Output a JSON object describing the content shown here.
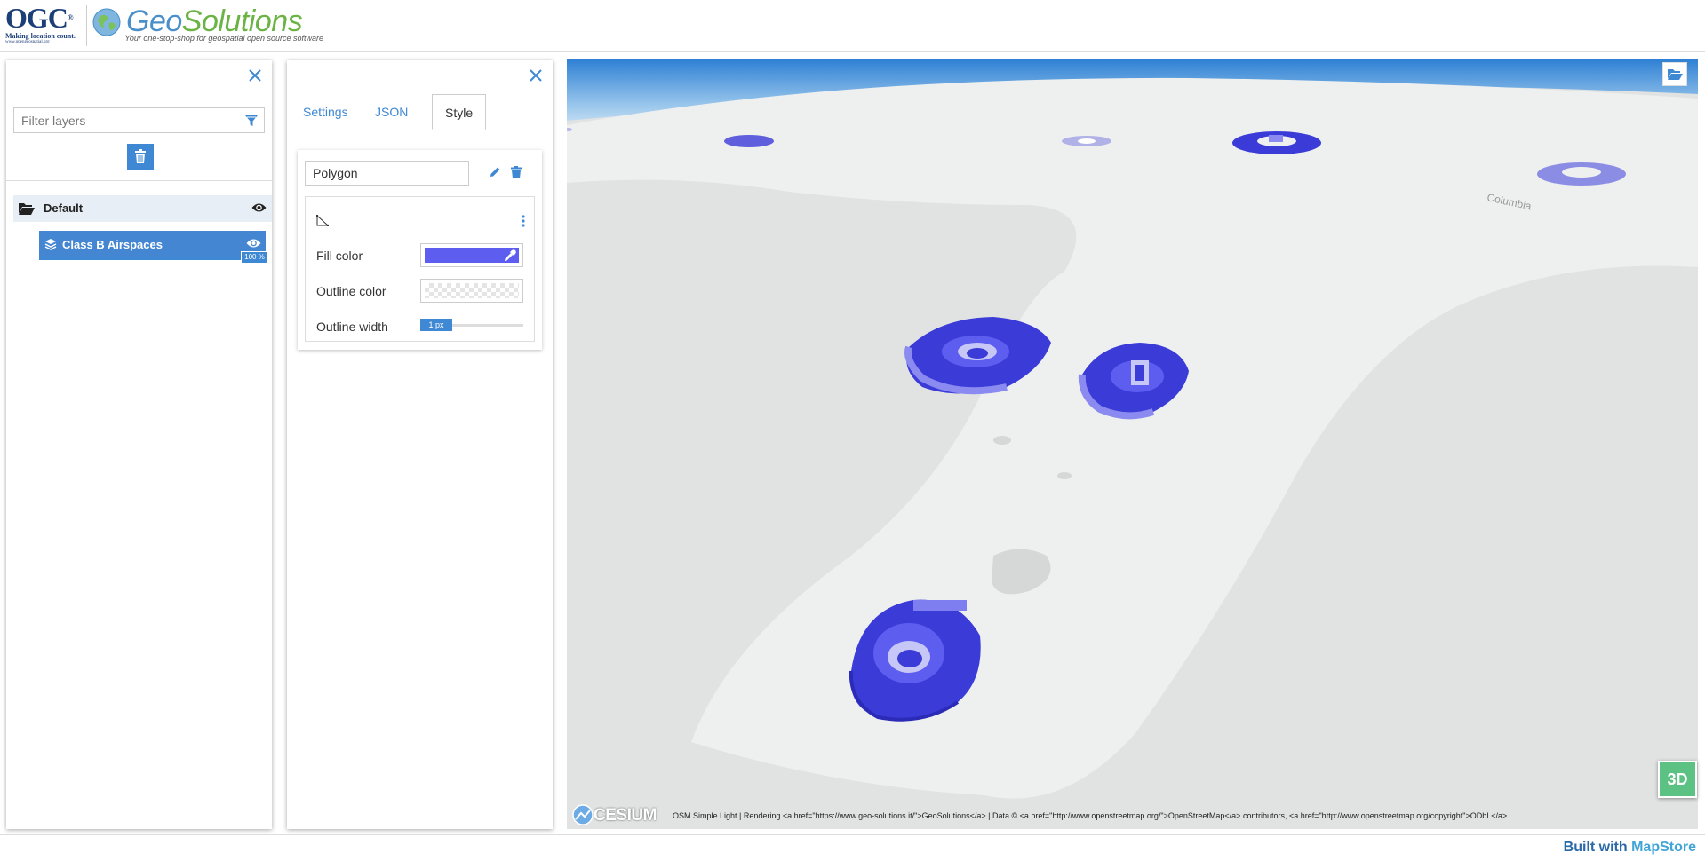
{
  "header": {
    "ogc": {
      "title": "OGC",
      "mark": "®",
      "tagline": "Making location count.",
      "url": "www.opengeospatial.org"
    },
    "geosolutions": {
      "title_geo": "Geo",
      "title_solutions": "Solutions",
      "tagline": "Your one-stop-shop for geospatial open source software"
    }
  },
  "toc": {
    "filter_placeholder": "Filter layers",
    "group": {
      "label": "Default"
    },
    "layer": {
      "label": "Class B Airspaces",
      "opacity": "100 %"
    }
  },
  "settings": {
    "tabs": {
      "settings": "Settings",
      "json": "JSON",
      "style": "Style"
    },
    "active_tab": "Style",
    "rule": {
      "name": "Polygon",
      "fill_color_label": "Fill color",
      "fill_color": "#5d5ef0",
      "outline_color_label": "Outline color",
      "outline_width_label": "Outline width",
      "outline_width": "1 px"
    }
  },
  "map": {
    "view_mode": "3D",
    "cesium_label": "CESIUM",
    "attribution": "OSM Simple Light | Rendering <a href=\"https://www.geo-solutions.it/\">GeoSolutions</a> | Data © <a href=\"http://www.openstreetmap.org/\">OpenStreetMap</a> contributors, <a href=\"http://www.openstreetmap.org/copyright\">ODbL</a>",
    "labels": {
      "columbia": "Columbia"
    },
    "airspace_color": "#3b3bd8"
  },
  "footer": {
    "built_with": "Built with",
    "mapstore": "MapStore"
  }
}
